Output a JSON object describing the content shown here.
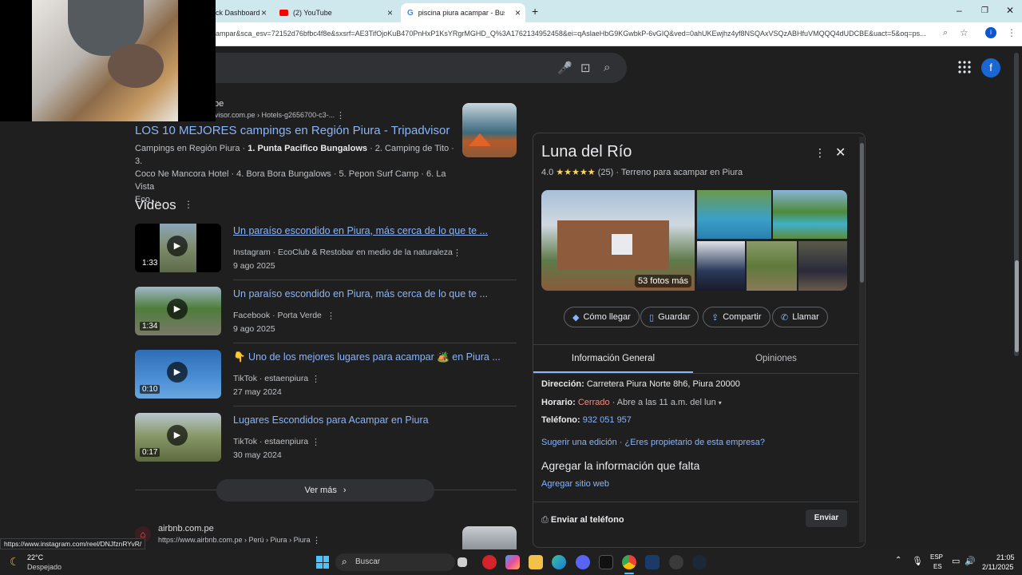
{
  "browser": {
    "tabs": [
      {
        "label": "ck Dashboard"
      },
      {
        "label": "(2) YouTube"
      },
      {
        "label": "piscina piura acampar - Buscar"
      }
    ],
    "url": "ampar&sca_esv=72152d76bfbc4f8e&sxsrf=AE3TifOjoKuB470PnHxP1KsYRgrMGHD_Q%3A1762134952458&ei=qAslaeHbG9KGwbkP-6vGIQ&ved=0ahUKEwjhz4yf8NSQAxVSQzABHfuVMQQQ4dUDCBE&uact=5&oq=ps...",
    "profile_initial": "i"
  },
  "top": {
    "profile_letter": "f"
  },
  "result_tripadvisor": {
    "site_fragment": "pe",
    "breadcrumb": "visor.com.pe › Hotels-g2656700-c3-...",
    "title": "LOS 10 MEJORES campings en Región Piura - Tripadvisor",
    "snippet_a": "Campings en Región Piura · ",
    "snippet_bold": "1. Punta Pacifico Bungalows",
    "snippet_b": " · 2. Camping de Tito · 3.",
    "snippet_line2": "Coco Ne Mancora Hotel · 4. Bora Bora Bungalows · 5. Pepon Surf Camp · 6. La Vista",
    "snippet_line3": "Eco ..."
  },
  "videos": {
    "heading": "Videos",
    "items": [
      {
        "title": "Un paraíso escondido en Piura, más cerca de lo que te ...",
        "source": "Instagram · EcoClub & Restobar en medio de la naturaleza",
        "date": "9 ago 2025",
        "duration": "1:33"
      },
      {
        "title": "Un paraíso escondido en Piura, más cerca de lo que te ...",
        "source": "Facebook · Porta Verde",
        "date": "9 ago 2025",
        "duration": "1:34"
      },
      {
        "title": "👇 Uno de los mejores lugares para acampar 🏕️ en Piura ...",
        "source": "TikTok · estaenpiura",
        "date": "27 may 2024",
        "duration": "0:10"
      },
      {
        "title": "Lugares Escondidos para Acampar en Piura",
        "source": "TikTok · estaenpiura",
        "date": "30 may 2024",
        "duration": "0:17"
      }
    ],
    "more_label": "Ver más"
  },
  "result_airbnb": {
    "site": "airbnb.com.pe",
    "breadcrumb": "https://www.airbnb.com.pe › Perú › Piura › Piura"
  },
  "status_url": "https://www.instagram.com/reel/DNJfznRYvR/",
  "knowledge_panel": {
    "title": "Luna del Río",
    "rating": "4.0",
    "stars": "★★★★★",
    "reviews": "(25)",
    "category": "Terreno para acampar en Piura",
    "photos_label": "53 fotos más",
    "actions": {
      "directions": "Cómo llegar",
      "save": "Guardar",
      "share": "Compartir",
      "call": "Llamar"
    },
    "tabs": {
      "general": "Información General",
      "reviews": "Opiniones"
    },
    "address_label": "Dirección:",
    "address_value": "Carretera Piura Norte 8h6, Piura 20000",
    "hours_label": "Horario:",
    "hours_status": "Cerrado",
    "hours_detail": " · Abre a las 11 a.m. del lun",
    "phone_label": "Teléfono:",
    "phone_value": "932 051 957",
    "suggest": "Sugerir una edición · ¿Eres propietario de esta empresa?",
    "missing_heading": "Agregar la información que falta",
    "add_website": "Agregar sitio web",
    "send_phone": "Enviar al teléfono",
    "send_button": "Enviar"
  },
  "taskbar": {
    "temp": "22°C",
    "weather": "Despejado",
    "search": "Buscar",
    "lang1": "ESP",
    "lang2": "ES",
    "time": "21:05",
    "date": "2/11/2025"
  }
}
